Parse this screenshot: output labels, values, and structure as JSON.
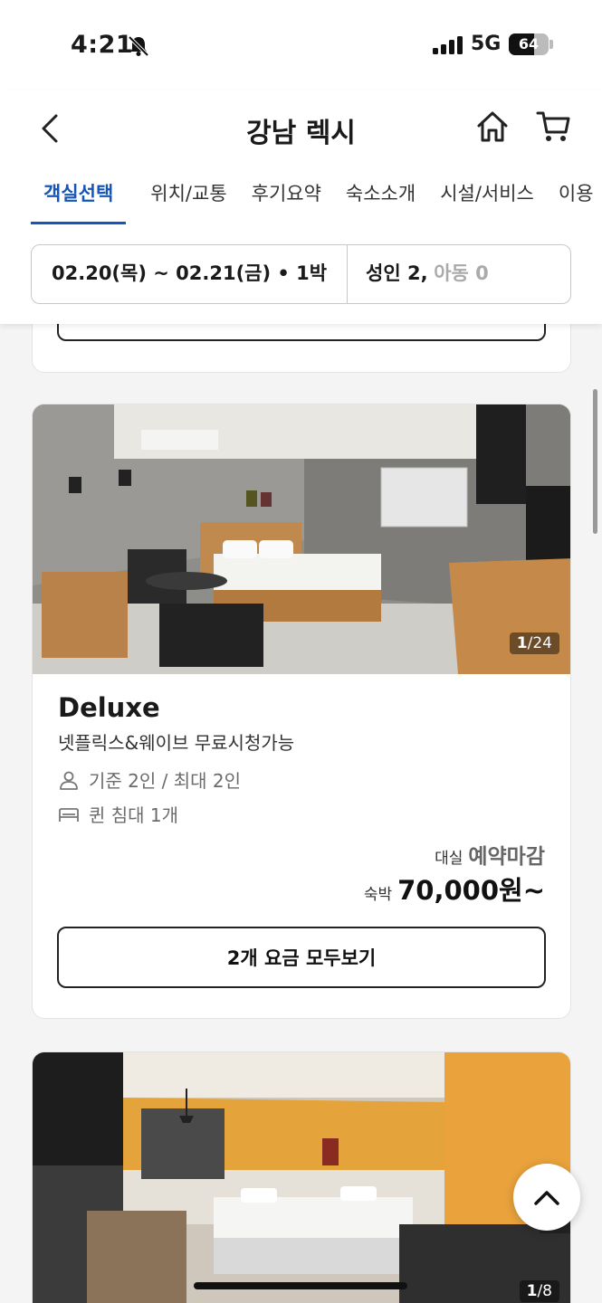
{
  "status_bar": {
    "time": "4:21",
    "network": "5G",
    "battery": "64",
    "battery_level": 0.64
  },
  "header": {
    "title": "강남 렉시"
  },
  "tabs": [
    {
      "label": "객실선택",
      "active": true
    },
    {
      "label": "위치/교통"
    },
    {
      "label": "후기요약"
    },
    {
      "label": "숙소소개"
    },
    {
      "label": "시설/서비스"
    },
    {
      "label": "이용"
    }
  ],
  "search": {
    "date": "02.20(목) ~ 02.21(금) • 1박",
    "adults": "성인 2,",
    "children": "아동 0"
  },
  "rooms": [
    {
      "name": "Deluxe",
      "description": "넷플릭스&웨이브 무료시청가능",
      "occupancy": "기준 2인 / 최대 2인",
      "bed": "퀸 침대 1개",
      "photo_index": "1",
      "photo_total": "/24",
      "day_label": "대실",
      "day_status": "예약마감",
      "night_label": "숙박",
      "night_price": "70,000원~",
      "all_rates_label": "2개 요금 모두보기"
    },
    {
      "photo_index": "1",
      "photo_total": "/8"
    }
  ],
  "icons": {
    "back": "chevron-left-icon",
    "home": "home-icon",
    "cart": "cart-icon",
    "person": "person-icon",
    "bed": "bed-icon",
    "top": "chevron-up-icon"
  }
}
